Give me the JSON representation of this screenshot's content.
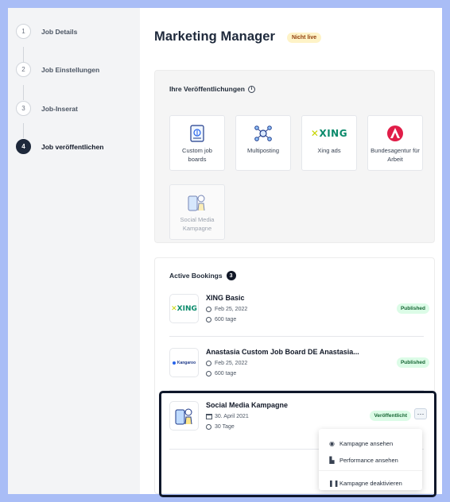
{
  "steps": [
    {
      "num": "1",
      "label": "Job Details"
    },
    {
      "num": "2",
      "label": "Job Einstellungen"
    },
    {
      "num": "3",
      "label": "Job-Inserat"
    },
    {
      "num": "4",
      "label": "Job veröffentlichen"
    }
  ],
  "header": {
    "title": "Marketing Manager",
    "status": "Nicht live"
  },
  "publications": {
    "title": "Ihre Veröffentlichungen",
    "cards": [
      {
        "label": "Custom job boards",
        "icon": "document-icon"
      },
      {
        "label": "Multiposting",
        "icon": "network-icon"
      },
      {
        "label": "Xing ads",
        "icon": "xing-logo",
        "logo_text": "XING"
      },
      {
        "label": "Bundesagentur für Arbeit",
        "icon": "bundesagentur-logo"
      },
      {
        "label": "Social Media Kampagne",
        "icon": "social-media-icon",
        "disabled": true
      }
    ]
  },
  "bookings": {
    "title": "Active Bookings",
    "count": "3",
    "items": [
      {
        "name": "XING Basic",
        "date": "Feb 25, 2022",
        "duration": "600 tage",
        "status": "Published",
        "logo_text": "XING"
      },
      {
        "name": "Anastasia Custom Job Board DE Anastasia...",
        "date": "Feb 25, 2022",
        "duration": "600 tage",
        "status": "Published",
        "logo_text": "Kangaroo"
      },
      {
        "name": "Social Media Kampagne",
        "date": "30. April 2021",
        "duration": "30 Tage",
        "status": "Veröffentlicht",
        "more": "···"
      }
    ]
  },
  "context_menu": {
    "items": [
      {
        "label": "Kampagne ansehen",
        "icon": "eye-icon"
      },
      {
        "label": "Performance ansehen",
        "icon": "bar-chart-icon"
      },
      {
        "label": "Kampagne deaktivieren",
        "icon": "pause-icon"
      }
    ]
  },
  "colors": {
    "background": "#a9bdf6",
    "accent": "#1e293b",
    "published": "#dcfce7",
    "not_live": "#fef3c7",
    "xing_green": "#0a8a6b"
  }
}
